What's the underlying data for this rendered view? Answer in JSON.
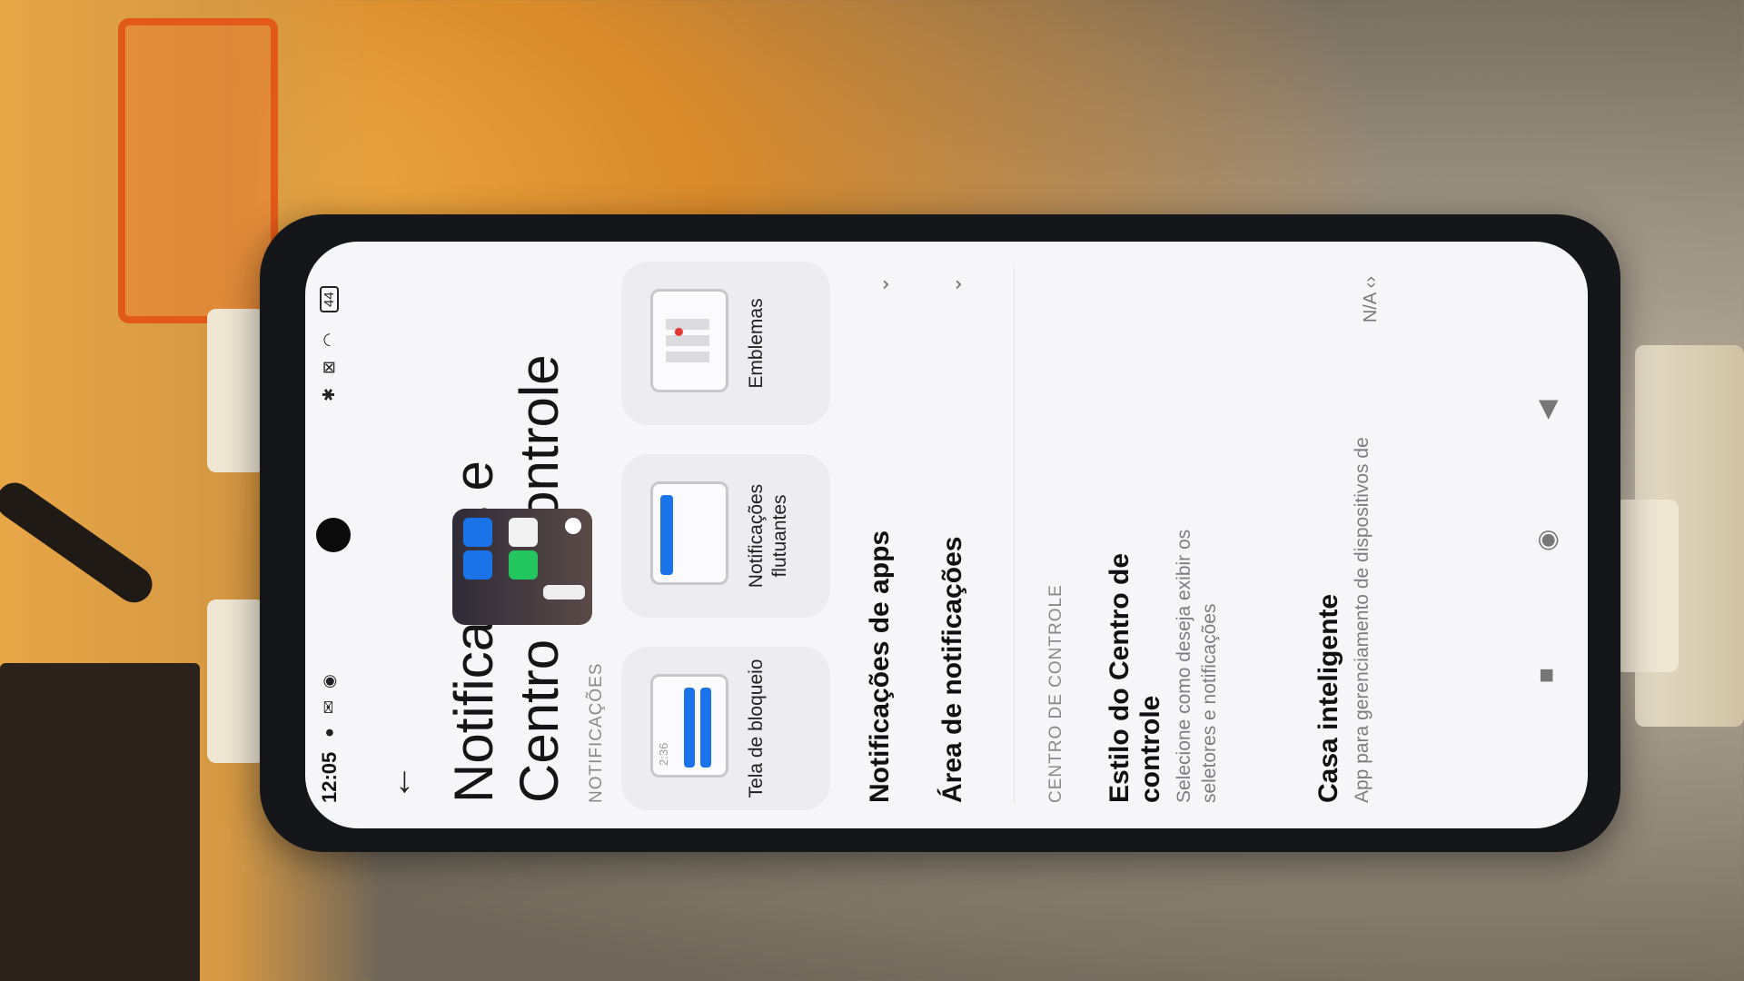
{
  "status_bar": {
    "time": "12:05",
    "left_icons": [
      "whatsapp-icon",
      "gmail-icon",
      "nav-icon"
    ],
    "right_icons": [
      "bluetooth-icon",
      "battery-saver-icon",
      "wifi-icon"
    ],
    "battery": "44"
  },
  "header": {
    "title": "Notificações e Centro de controle"
  },
  "notifications_section": {
    "label": "NOTIFICAÇÕES",
    "cards": [
      {
        "label": "Tela de bloqueio",
        "thumb_time": "2:36"
      },
      {
        "label": "Notificações flutuantes"
      },
      {
        "label": "Emblemas"
      }
    ],
    "rows": [
      {
        "title": "Notificações de apps"
      },
      {
        "title": "Área de notificações"
      }
    ]
  },
  "control_center_section": {
    "label": "CENTRO DE CONTROLE",
    "style": {
      "title": "Estilo do Centro de controle",
      "description": "Selecione como deseja exibir os seletores e notificações"
    },
    "smart_home": {
      "title": "Casa inteligente",
      "description": "App para gerenciamento de dispositivos de",
      "value": "N/A"
    }
  },
  "nav_bar": {
    "recents_icon": "square-icon",
    "home_icon": "circle-icon",
    "back_icon": "triangle-icon"
  },
  "colors": {
    "accent": "#1a73e8",
    "green_tile": "#22c55e",
    "badge_dot": "#e53935"
  }
}
